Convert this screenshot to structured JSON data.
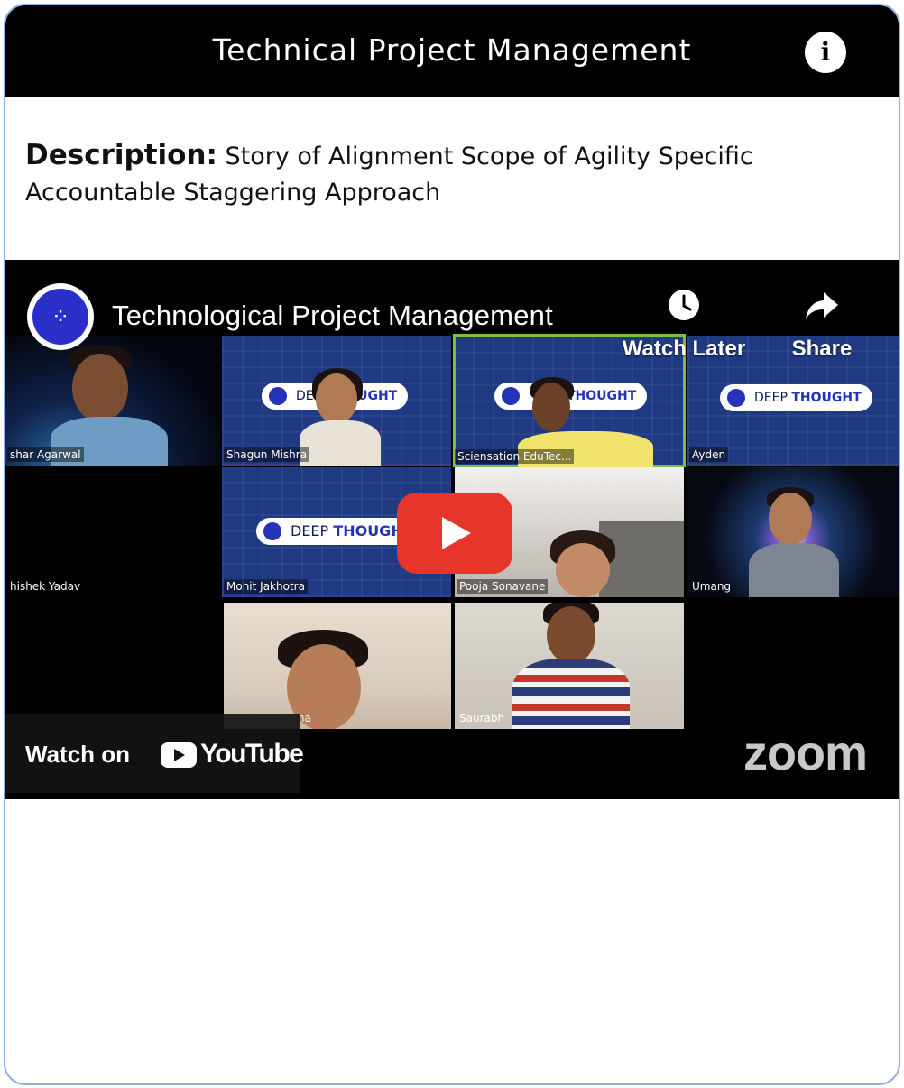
{
  "card": {
    "title": "Technical Project Management",
    "info_icon": "i",
    "description_label": "Description:",
    "description_text": "Story of Alignment Scope of Agility Specific Accountable Staggering Approach"
  },
  "video": {
    "title": "Technological Project Management",
    "watch_later_label": "Watch Later",
    "share_label": "Share",
    "watch_on_label": "Watch on",
    "youtube_label": "YouTube",
    "zoom_label": "zoom",
    "deep_label": "DEEP",
    "thought_label": "THOUGHT",
    "participants": [
      {
        "name": "shar Agarwal"
      },
      {
        "name": "Shagun Mishra"
      },
      {
        "name": "Sciensation EduTec..."
      },
      {
        "name": "Ayden"
      },
      {
        "name": "hishek Yadav"
      },
      {
        "name": "Mohit Jakhotra"
      },
      {
        "name": "Pooja Sonavane"
      },
      {
        "name": "Umang"
      },
      {
        "name": "Lokesh Sharma"
      },
      {
        "name": "Saurabh"
      }
    ],
    "pills": [
      {
        "deep": "DE",
        "thought": "UGHT"
      },
      {
        "deep": "",
        "thought": "THOUGHT"
      },
      {
        "deep": "DEEP",
        "thought": "THOUGHT"
      },
      {
        "deep": "DEEP",
        "thought": "THOUGH"
      }
    ]
  },
  "icons": {
    "info": "info-icon",
    "clock": "clock-icon",
    "share": "share-arrow-icon",
    "play": "play-icon",
    "youtube": "youtube-logo-icon"
  }
}
